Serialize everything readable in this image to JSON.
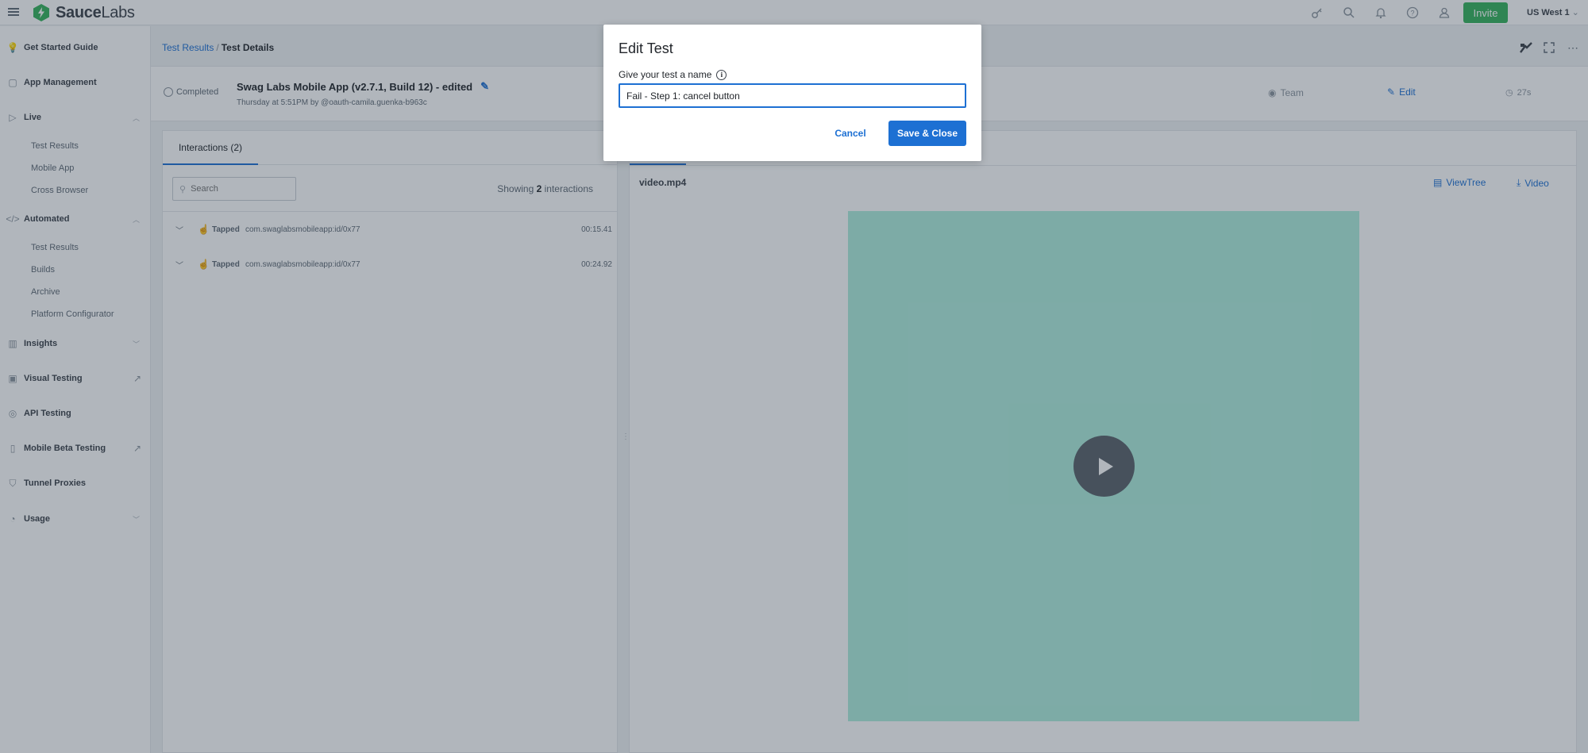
{
  "brand": {
    "name_part1": "Sauce",
    "name_part2": "Labs",
    "accent": "#35b35b"
  },
  "topbar": {
    "icons": [
      "key-icon",
      "search-icon",
      "bell-icon",
      "help-icon",
      "user-icon"
    ],
    "invite_label": "Invite",
    "region": "US West 1"
  },
  "sidebar": {
    "items": [
      {
        "label": "Get Started Guide",
        "icon": "bulb-icon"
      },
      {
        "label": "App Management",
        "icon": "apps-icon"
      },
      {
        "label": "Live",
        "icon": "play-icon"
      },
      {
        "label": "Automated",
        "icon": "code-icon"
      },
      {
        "label": "Insights",
        "icon": "bar-chart-icon"
      },
      {
        "label": "Visual Testing",
        "icon": "image-icon"
      },
      {
        "label": "API Testing",
        "icon": "api-icon"
      },
      {
        "label": "Mobile Beta Testing",
        "icon": "phone-icon"
      },
      {
        "label": "Tunnel Proxies",
        "icon": "shield-icon"
      },
      {
        "label": "Usage",
        "icon": "gauge-icon"
      }
    ],
    "live_sub": [
      "Test Results",
      "Mobile App",
      "Cross Browser"
    ],
    "automated_sub": [
      "Test Results",
      "Builds",
      "Archive",
      "Platform Configurator"
    ]
  },
  "breadcrumb": {
    "parent": "Test Results",
    "separator": "/",
    "current": "Test Details"
  },
  "test": {
    "status": "Completed",
    "name": "Swag Labs Mobile App (v2.7.1, Build 12) - edited",
    "meta": "Thursday at 5:51PM by @oauth-camila.guenka-b963c",
    "visibility": "Team",
    "edit_label": "Edit",
    "duration": "27s"
  },
  "interactions": {
    "tab_label": "Interactions (2)",
    "search_placeholder": "Search",
    "showing_prefix": "Showing",
    "showing_count": "2",
    "showing_suffix": "interactions",
    "rows": [
      {
        "action": "Tapped",
        "target": "com.swaglabsmobileapp:id/0x77",
        "time": "00:15.41"
      },
      {
        "action": "Tapped",
        "target": "com.swaglabsmobileapp:id/0x77",
        "time": "00:24.92"
      }
    ]
  },
  "video": {
    "title": "video.mp4",
    "viewtree_label": "ViewTree",
    "download_label": "Video",
    "background": "#aeeedd"
  },
  "modal": {
    "title": "Edit Test",
    "field_label": "Give your test a name",
    "input_value": "Fail - Step 1: cancel button",
    "cancel_label": "Cancel",
    "save_label": "Save & Close",
    "primary_color": "#1d70d3"
  }
}
